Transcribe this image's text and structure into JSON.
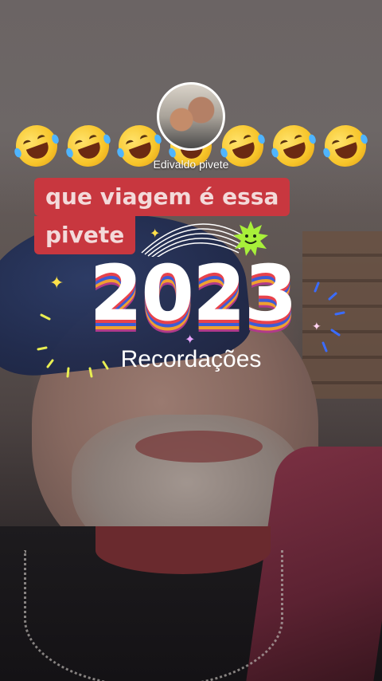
{
  "story": {
    "username": "Edivaldo pivete",
    "emoji_count": 7,
    "emoji_name": "rolling-on-floor-laughing",
    "caption_line1": "que viagem é essa",
    "caption_line2": "pivete",
    "caption_bg_color": "#c8373f",
    "sticker": {
      "year": "2023",
      "label": "Recordações"
    }
  }
}
